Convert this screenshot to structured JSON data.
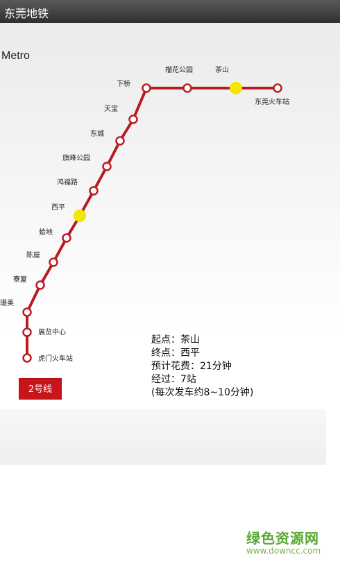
{
  "app": {
    "title": "东莞地铁"
  },
  "map": {
    "title": "Metro",
    "line_color": "#b81c22",
    "highlight_color": "#f5e600",
    "stations": [
      {
        "name": "东莞火车站"
      },
      {
        "name": "茶山",
        "highlight": true
      },
      {
        "name": "榴花公园"
      },
      {
        "name": "下桥"
      },
      {
        "name": "天宝"
      },
      {
        "name": "东城"
      },
      {
        "name": "旗峰公园"
      },
      {
        "name": "鸿福路"
      },
      {
        "name": "西平",
        "highlight": true
      },
      {
        "name": "蛤地"
      },
      {
        "name": "陈屋"
      },
      {
        "name": "寮厦"
      },
      {
        "name": "珊美"
      },
      {
        "name": "展览中心"
      },
      {
        "name": "虎门火车站"
      }
    ]
  },
  "info": {
    "start": "起点：茶山",
    "end": "终点：西平",
    "cost": "预计花费：21分钟",
    "via": "经过：7站",
    "interval": "(每次发车约8~10分钟)"
  },
  "line_button": {
    "label": "2号线",
    "color": "#c8141a"
  },
  "watermark": {
    "name": "绿色资源网",
    "url": "www.downcc.com"
  }
}
